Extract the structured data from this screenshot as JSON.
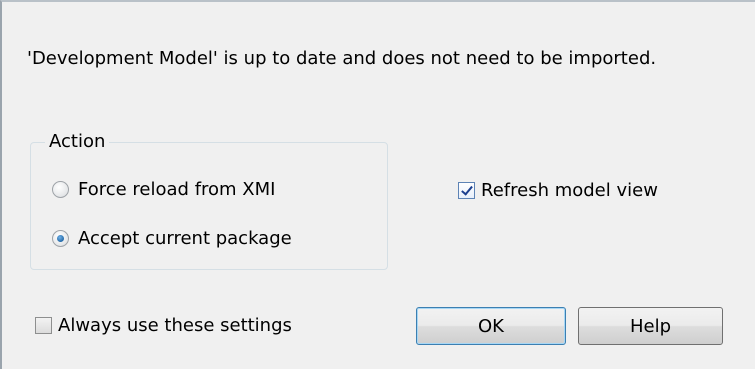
{
  "dialog": {
    "message": "'Development Model'  is up to date and does not need to be imported.",
    "action_group": {
      "title": "Action",
      "options": [
        {
          "label": "Force reload from XMI",
          "selected": false
        },
        {
          "label": "Accept current package",
          "selected": true
        }
      ]
    },
    "refresh_model_view": {
      "label": "Refresh model view",
      "checked": true
    },
    "always_use_settings": {
      "label": "Always use these settings",
      "checked": false
    },
    "buttons": {
      "ok_label": "OK",
      "help_label": "Help"
    }
  }
}
